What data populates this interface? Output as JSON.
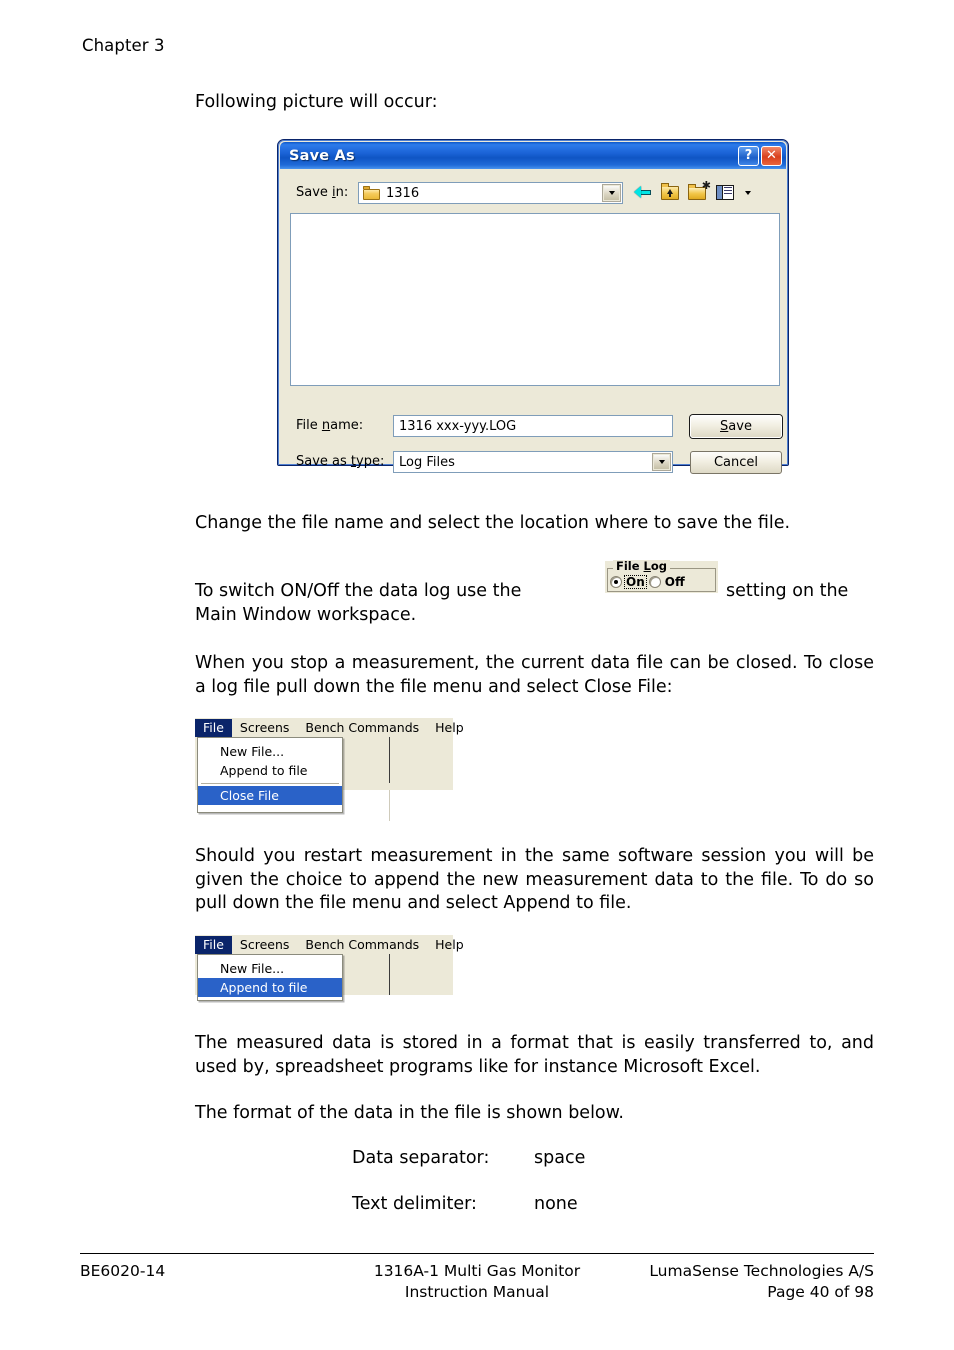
{
  "page": {
    "chapter": "Chapter 3",
    "intro": "Following picture will occur:",
    "para_change": "Change the file name and select the location where to save the file.",
    "para_switch_pre": "To  switch  ON/Off  the  data  log  use  the",
    "para_switch_post": "setting  on  the",
    "para_switch_line2": "Main Window workspace.",
    "para_stop": "When  you  stop  a  measurement,  the  current  data  file  can  be  closed. To close a log file pull down the file menu and select Close File:",
    "para_restart": "Should  you  restart  measurement  in  the  same  software  session  you will  be  given  the  choice  to  append  the  new  measurement  data  to  the file. To do so pull down the file menu and select Append to file.",
    "para_stored": "The  measured  data  is  stored  in  a  format  that  is  easily  transferred  to, and used by, spreadsheet programs like for instance Microsoft Excel.",
    "para_format": "The format of the data in the file is shown below."
  },
  "definitions": [
    {
      "term": "Data separator:",
      "value": "space"
    },
    {
      "term": "Text delimiter:",
      "value": "none"
    }
  ],
  "save_as_dialog": {
    "title": "Save As",
    "help_button": "?",
    "close_button": "✕",
    "save_in_label_a": "Save ",
    "save_in_label_u": "i",
    "save_in_label_b": "n:",
    "save_in_value": "1316",
    "toolbar_icons": [
      "back-arrow-icon",
      "up-one-level-icon",
      "new-folder-icon",
      "views-icon"
    ],
    "file_name_label_a": "File ",
    "file_name_label_u": "n",
    "file_name_label_b": "ame:",
    "file_name_value": "1316 xxx-yyy.LOG",
    "save_as_type_label_a": "Save as ",
    "save_as_type_label_u": "t",
    "save_as_type_label_b": "ype:",
    "save_as_type_value": "Log Files",
    "save_button_a": "S",
    "save_button_b": "ave",
    "cancel_button": "Cancel"
  },
  "file_log_widget": {
    "legend_a": "File ",
    "legend_u": "L",
    "legend_b": "og",
    "on_label": "On",
    "off_label": "Off",
    "selected": "On"
  },
  "menu_close_file": {
    "menubar": [
      "File",
      "Screens",
      "Bench Commands",
      "Help"
    ],
    "active_menubar_item": "File",
    "items": [
      {
        "label": "New File...",
        "selected": false
      },
      {
        "label": "Append to file",
        "selected": false
      },
      {
        "separator": true
      },
      {
        "label": "Close File",
        "selected": true
      }
    ]
  },
  "menu_append_file": {
    "menubar": [
      "File",
      "Screens",
      "Bench Commands",
      "Help"
    ],
    "active_menubar_item": "File",
    "items": [
      {
        "label": "New File...",
        "selected": false
      },
      {
        "label": "Append to file",
        "selected": true
      }
    ]
  },
  "footer": {
    "left": "BE6020-14",
    "mid_line1": "1316A-1 Multi Gas Monitor",
    "mid_line2": "Instruction Manual",
    "right_line1": "LumaSense Technologies A/S",
    "right_line2": "Page 40 of 98"
  },
  "colors": {
    "titlebar_blue": "#1a62d6",
    "dialog_face": "#ece9d8",
    "menu_highlight": "#2a62c8",
    "menubar_active": "#0a246a",
    "close_red": "#d9401c"
  }
}
